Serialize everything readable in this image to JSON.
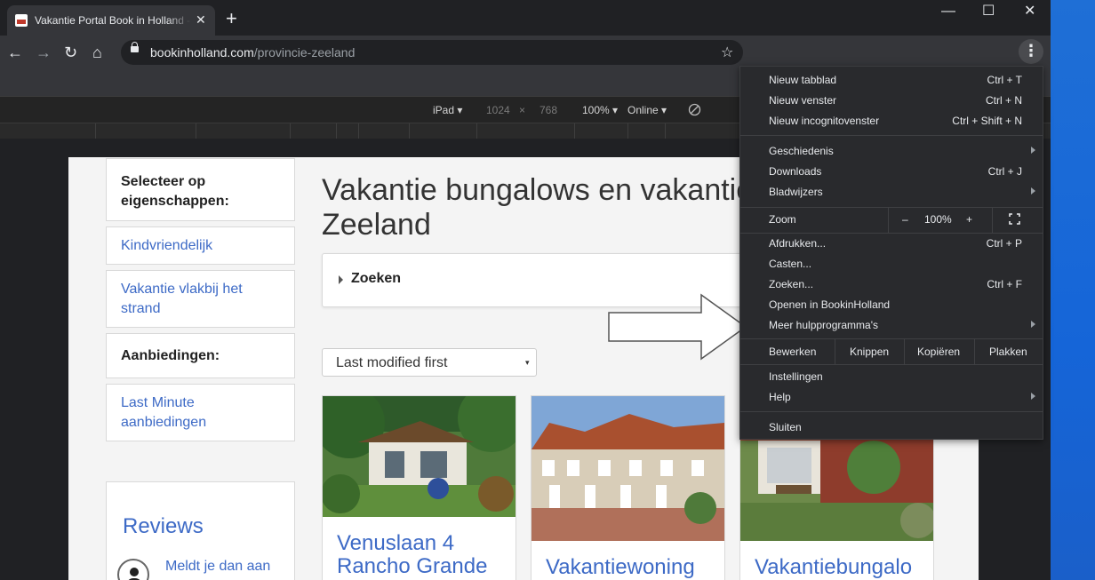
{
  "tab": {
    "title": "Vakantie Portal Book in Holland - Vakantie",
    "close": "✕",
    "new_tab": "+"
  },
  "window": {
    "minimize": "—",
    "maximize": "☐",
    "close": "✕"
  },
  "toolbar": {
    "back": "←",
    "forward": "→",
    "reload": "↻",
    "home": "⌂",
    "url_host": "bookinholland.com",
    "url_path": "/provincie-zeeland",
    "star": "☆",
    "menu": "⋮"
  },
  "devtools": {
    "device": "iPad ▾",
    "width": "1024",
    "times": "×",
    "height": "768",
    "zoom": "100% ▾",
    "network": "Online ▾"
  },
  "sidebar": {
    "filter_heading": "Selecteer op eigenschappen:",
    "filters": [
      "Kindvriendelijk",
      "Vakantie vlakbij het strand"
    ],
    "offers_heading": "Aanbiedingen:",
    "offers": [
      "Last Minute aanbiedingen"
    ],
    "reviews_title": "Reviews",
    "reviews_text": "Meldt je dan aan"
  },
  "main": {
    "heading_line1": "Vakantie bungalows en vakantiehuizen",
    "heading_line2": "Zeeland",
    "search_label": "Zoeken",
    "sort_value": "Last modified first",
    "sort_arrow": "▾",
    "properties": [
      {
        "title_line1": "Venuslaan 4",
        "title_line2": "Rancho Grande"
      },
      {
        "title_line1": "Vakantiewoning",
        "title_line2": ""
      },
      {
        "title_line1": "Vakantiebungalo",
        "title_line2": ""
      }
    ]
  },
  "menu": {
    "group1": [
      {
        "label": "Nieuw tabblad",
        "shortcut": "Ctrl + T"
      },
      {
        "label": "Nieuw venster",
        "shortcut": "Ctrl + N"
      },
      {
        "label": "Nieuw incognitovenster",
        "shortcut": "Ctrl + Shift + N"
      }
    ],
    "group2": [
      {
        "label": "Geschiedenis",
        "shortcut": ""
      },
      {
        "label": "Downloads",
        "shortcut": "Ctrl + J"
      },
      {
        "label": "Bladwijzers",
        "shortcut": ""
      }
    ],
    "zoom": {
      "label": "Zoom",
      "minus": "–",
      "value": "100%",
      "plus": "+"
    },
    "group3": [
      {
        "label": "Afdrukken...",
        "shortcut": "Ctrl + P"
      },
      {
        "label": "Casten...",
        "shortcut": ""
      },
      {
        "label": "Zoeken...",
        "shortcut": "Ctrl + F"
      },
      {
        "label": "Openen in BookinHolland",
        "shortcut": ""
      },
      {
        "label": "Meer hulpprogramma's",
        "shortcut": ""
      }
    ],
    "edit": {
      "label": "Bewerken",
      "cut": "Knippen",
      "copy": "Kopiëren",
      "paste": "Plakken"
    },
    "group4": [
      {
        "label": "Instellingen",
        "shortcut": ""
      },
      {
        "label": "Help",
        "shortcut": ""
      }
    ],
    "exit": "Sluiten"
  }
}
